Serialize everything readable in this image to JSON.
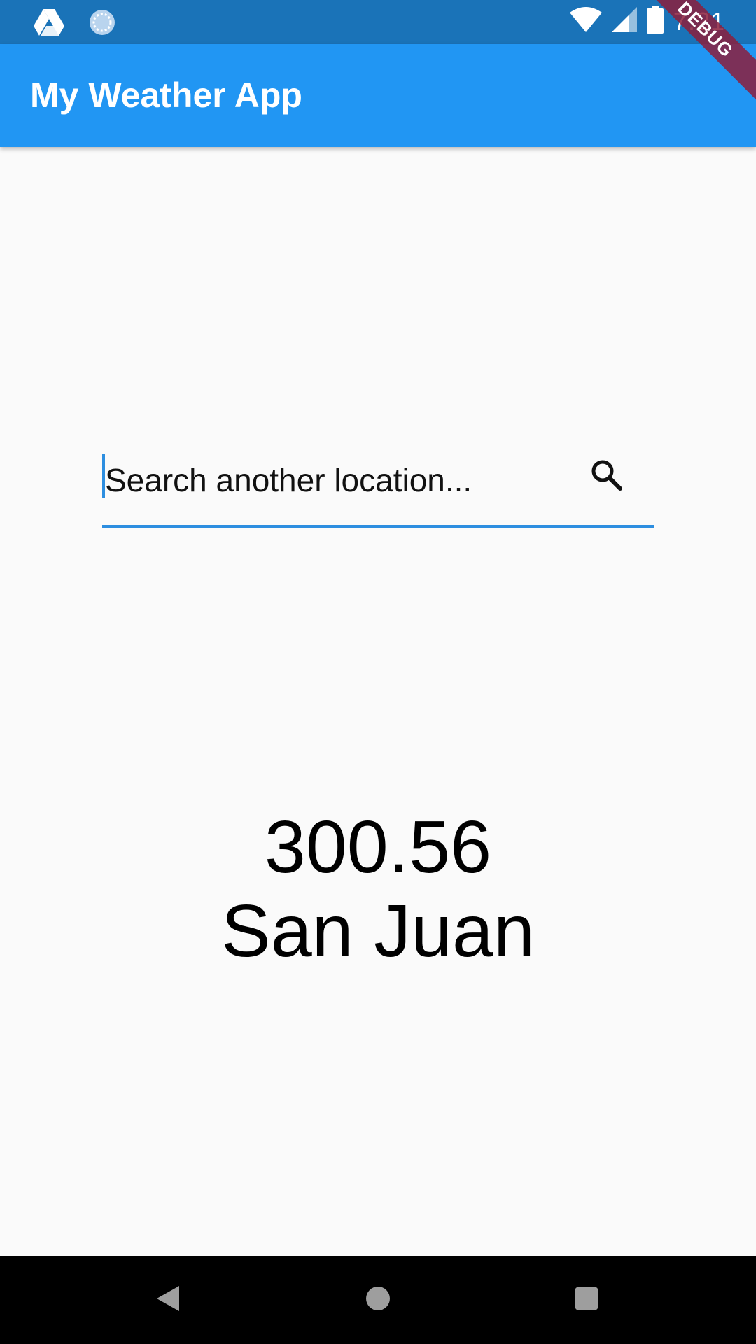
{
  "status_bar": {
    "time": "7:21",
    "left_icons": [
      "drive-icon",
      "sync-icon"
    ],
    "right_icons": [
      "wifi-icon",
      "signal-icon",
      "battery-icon"
    ],
    "background": "#1a73b8"
  },
  "app_bar": {
    "title": "My Weather App",
    "background": "#2196f3"
  },
  "debug_banner": {
    "label": "DEBUG"
  },
  "search": {
    "placeholder": "Search another location...",
    "value": "",
    "icon": "search-icon",
    "accent": "#2d8ee0"
  },
  "weather": {
    "temperature": "300.56",
    "city": "San Juan"
  },
  "nav_bar": {
    "buttons": [
      "back-icon",
      "home-icon",
      "recents-icon"
    ]
  }
}
